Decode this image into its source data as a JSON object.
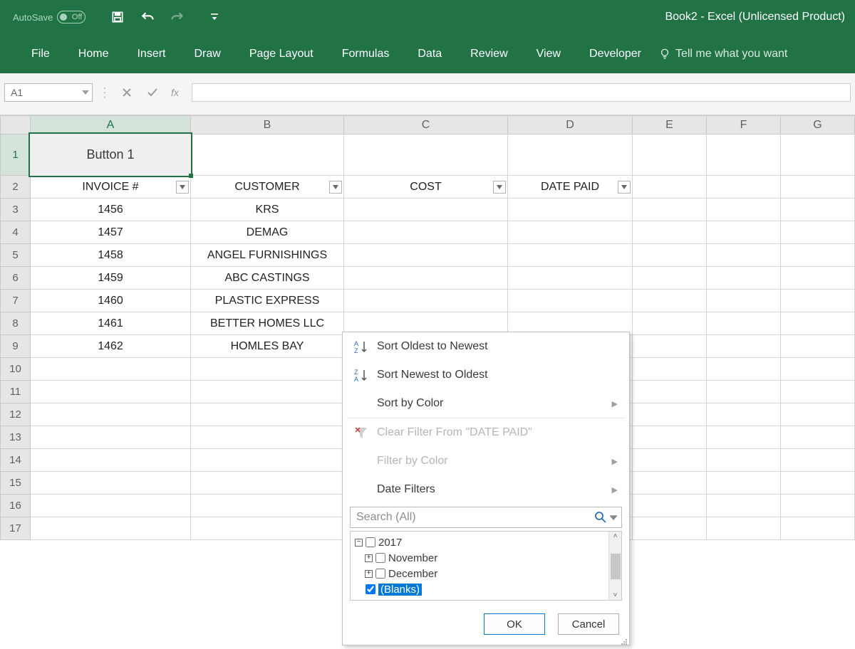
{
  "titlebar": {
    "autosave_label": "AutoSave",
    "autosave_state": "Off",
    "title": "Book2  -  Excel (Unlicensed Product)"
  },
  "ribbon": {
    "tabs": [
      "File",
      "Home",
      "Insert",
      "Draw",
      "Page Layout",
      "Formulas",
      "Data",
      "Review",
      "View",
      "Developer"
    ],
    "tell_me": "Tell me what you want"
  },
  "formula_bar": {
    "name_box": "A1",
    "fx_label": "fx",
    "formula": ""
  },
  "columns": [
    "A",
    "B",
    "C",
    "D",
    "E",
    "F",
    "G"
  ],
  "button_label": "Button 1",
  "table": {
    "headers": {
      "a": "INVOICE #",
      "b": "CUSTOMER",
      "c": "COST",
      "d": "DATE PAID"
    },
    "rows": [
      {
        "a": "1456",
        "b": "KRS"
      },
      {
        "a": "1457",
        "b": "DEMAG"
      },
      {
        "a": "1458",
        "b": "ANGEL FURNISHINGS"
      },
      {
        "a": "1459",
        "b": "ABC CASTINGS"
      },
      {
        "a": "1460",
        "b": "PLASTIC EXPRESS"
      },
      {
        "a": "1461",
        "b": "BETTER HOMES LLC"
      },
      {
        "a": "1462",
        "b": "HOMLES BAY"
      }
    ]
  },
  "filter_popup": {
    "sort_asc": "Sort Oldest to Newest",
    "sort_desc": "Sort Newest to Oldest",
    "sort_color": "Sort by Color",
    "clear_filter": "Clear Filter From \"DATE PAID\"",
    "filter_color": "Filter by Color",
    "date_filters": "Date Filters",
    "search_placeholder": "Search (All)",
    "tree": {
      "year": "2017",
      "months": [
        "November",
        "December"
      ],
      "blanks": "(Blanks)"
    },
    "ok": "OK",
    "cancel": "Cancel"
  }
}
